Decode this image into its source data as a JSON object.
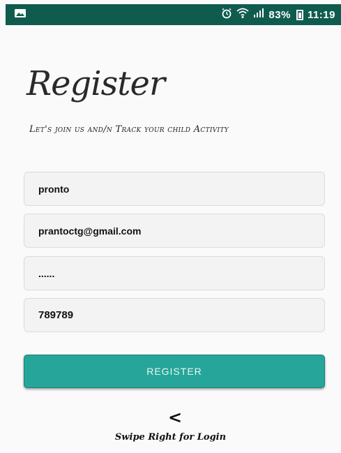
{
  "status_bar": {
    "left_icon": "image-icon",
    "alarm_icon": "alarm-icon",
    "wifi_icon": "wifi-icon",
    "signal_icon": "signal-icon",
    "battery_text": "83%",
    "time": "11:19"
  },
  "title": "Register",
  "subtitle": "Let's join us and/n Track your child Activity",
  "form": {
    "name_value": "pronto",
    "email_value": "prantoctg@gmail.com",
    "password_value": "......",
    "phone_value": "789789"
  },
  "register_label": "REGISTER",
  "chevron": "<",
  "swipe_text": "Swipe Right for Login",
  "colors": {
    "status_bar": "#0f5c4e",
    "button": "#26a69a"
  }
}
